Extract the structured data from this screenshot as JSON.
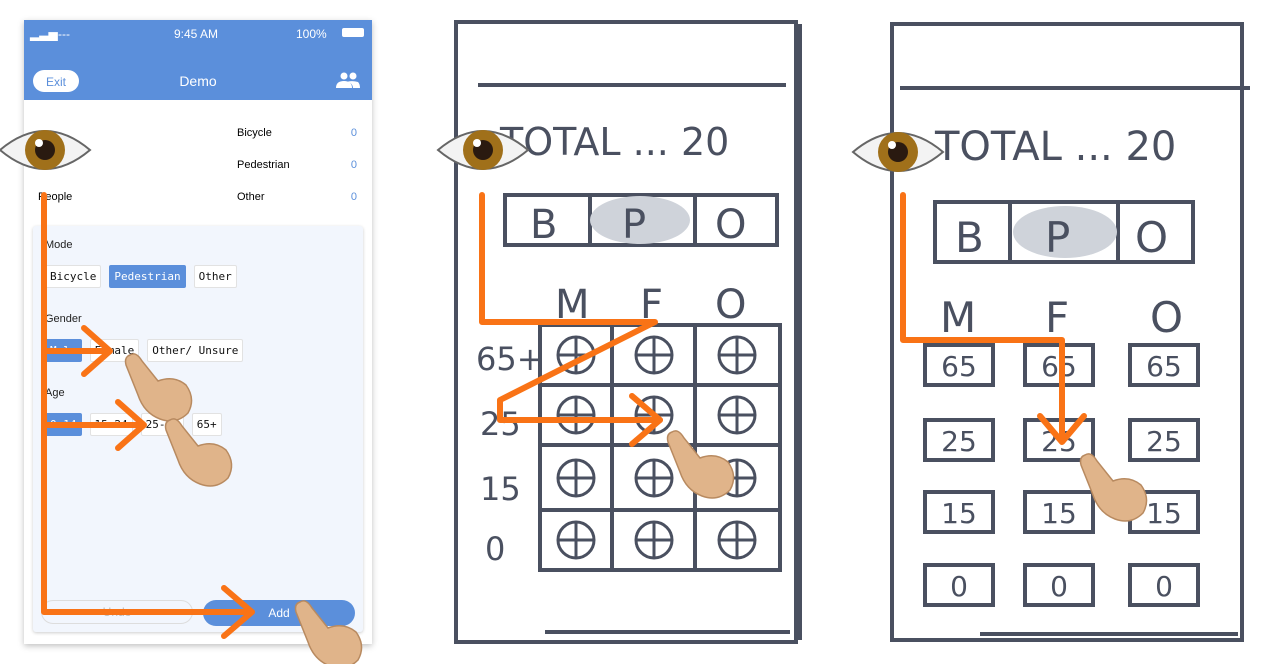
{
  "phone": {
    "status_bar": {
      "signal": "----",
      "time": "9:45 AM",
      "battery": "100%"
    },
    "header": {
      "exit_label": "Exit",
      "title": "Demo",
      "icon": "people-icon"
    },
    "counts": {
      "people_label": "People",
      "items": [
        {
          "label": "Bicycle",
          "value": "0"
        },
        {
          "label": "Pedestrian",
          "value": "0"
        },
        {
          "label": "Other",
          "value": "0"
        }
      ]
    },
    "form": {
      "mode": {
        "label": "Mode",
        "options": [
          "Bicycle",
          "Pedestrian",
          "Other"
        ],
        "selected": "Pedestrian"
      },
      "gender": {
        "label": "Gender",
        "options": [
          "Male",
          "Female",
          "Other/ Unsure"
        ],
        "selected": "Male"
      },
      "age": {
        "label": "Age",
        "options": [
          "0-14",
          "15-24",
          "25-64",
          "65+"
        ],
        "selected": "0-14"
      },
      "undo_label": "Undo",
      "add_label": "Add"
    }
  },
  "sketch1": {
    "total": "TOTAL ... 20",
    "modes": [
      "B",
      "P",
      "O"
    ],
    "genders": [
      "M",
      "F",
      "O"
    ],
    "ages": [
      "65+",
      "25",
      "15",
      "0"
    ]
  },
  "sketch2": {
    "total": "TOTAL ... 20",
    "modes": [
      "B",
      "P",
      "O"
    ],
    "genders": [
      "M",
      "F",
      "O"
    ],
    "ages": [
      "65",
      "25",
      "15",
      "0"
    ]
  },
  "colors": {
    "accent": "#5b8fdb",
    "arrow": "#f97316",
    "sketch": "#4a5060",
    "highlight": "#cfd3da"
  }
}
